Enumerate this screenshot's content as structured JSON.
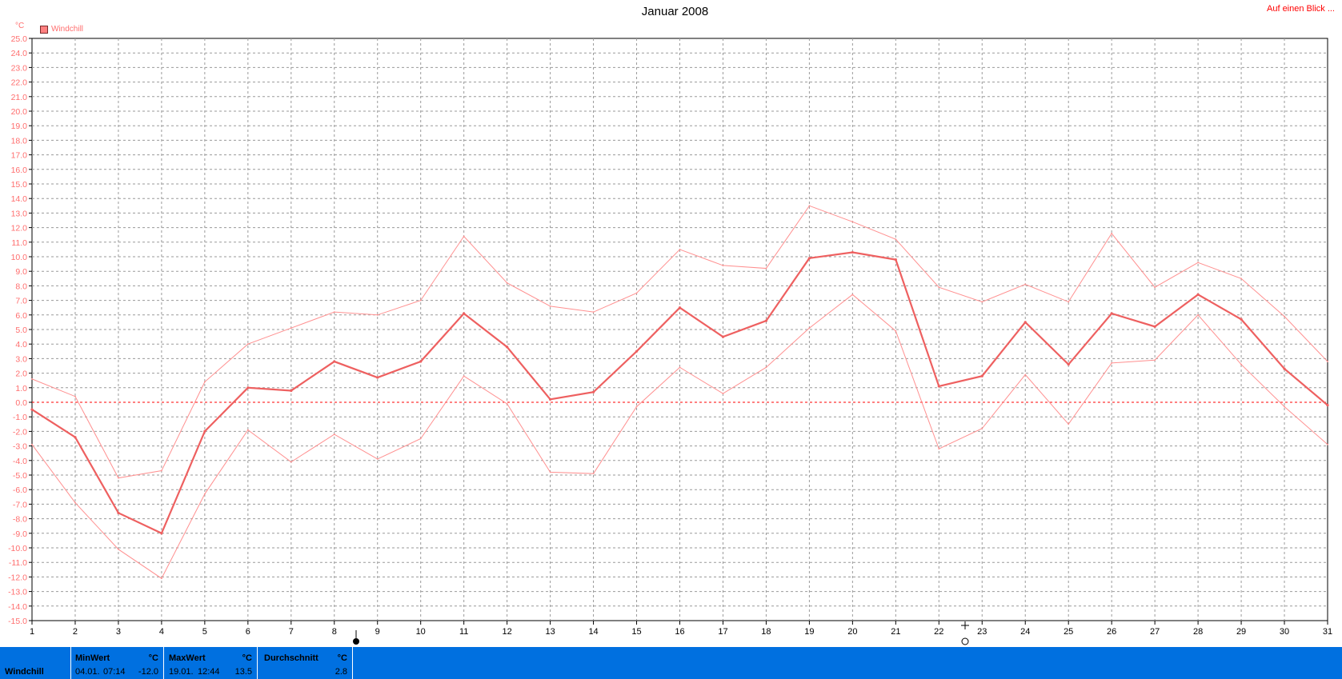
{
  "title": "Januar 2008",
  "link_label": "Auf einen Blick ...",
  "unit": "°C",
  "legend": {
    "label": "Windchill",
    "color": "#ff8080"
  },
  "chart_data": {
    "type": "line",
    "title": "Januar 2008",
    "ylabel": "°C",
    "ylim": [
      -15,
      25
    ],
    "ytick_step": 1,
    "x": [
      1,
      2,
      3,
      4,
      5,
      6,
      7,
      8,
      9,
      10,
      11,
      12,
      13,
      14,
      15,
      16,
      17,
      18,
      19,
      20,
      21,
      22,
      23,
      24,
      25,
      26,
      27,
      28,
      29,
      30,
      31
    ],
    "grid": true,
    "zero_line": true,
    "series": [
      {
        "name": "Windchill",
        "role": "mean",
        "color": "#ee6060",
        "values": [
          -0.5,
          -2.4,
          -7.6,
          -9.0,
          -2.0,
          1.0,
          0.8,
          2.8,
          1.7,
          2.8,
          6.1,
          3.8,
          0.2,
          0.7,
          3.5,
          6.5,
          4.5,
          5.6,
          9.9,
          10.3,
          9.8,
          1.1,
          1.8,
          5.5,
          2.6,
          6.1,
          5.2,
          7.4,
          5.7,
          2.3,
          -0.2
        ]
      },
      {
        "role": "max",
        "color": "#ff9090",
        "values": [
          1.6,
          0.4,
          -5.2,
          -4.7,
          1.4,
          4.0,
          5.1,
          6.2,
          6.0,
          7.0,
          11.4,
          8.2,
          6.6,
          6.2,
          7.5,
          10.5,
          9.4,
          9.2,
          13.5,
          12.4,
          11.2,
          7.9,
          6.9,
          8.1,
          6.9,
          11.6,
          7.9,
          9.6,
          8.5,
          5.9,
          2.8
        ]
      },
      {
        "role": "min",
        "color": "#ff9090",
        "values": [
          -2.9,
          -6.9,
          -10.1,
          -12.1,
          -6.3,
          -1.9,
          -4.1,
          -2.2,
          -3.9,
          -2.5,
          1.8,
          -0.1,
          -4.8,
          -4.9,
          -0.3,
          2.4,
          0.6,
          2.4,
          5.1,
          7.4,
          4.9,
          -3.2,
          -1.8,
          1.9,
          -1.5,
          2.7,
          2.9,
          6.0,
          2.6,
          -0.3,
          -2.9
        ]
      }
    ]
  },
  "stats": {
    "row_label": "Windchill",
    "min": {
      "header": "MinWert",
      "unit": "°C",
      "date": "04.01.",
      "time": "07:14",
      "value": "-12.0"
    },
    "max": {
      "header": "MaxWert",
      "unit": "°C",
      "date": "19.01.",
      "time": "12:44",
      "value": "13.5"
    },
    "avg": {
      "header": "Durchschnitt",
      "unit": "°C",
      "value": "2.8"
    }
  }
}
